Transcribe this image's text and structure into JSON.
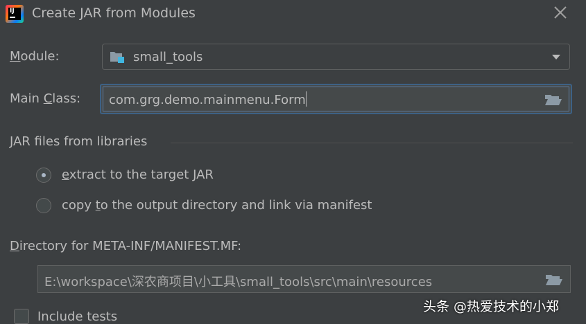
{
  "window": {
    "title": "Create JAR from Modules",
    "app_icon_label": "IJ"
  },
  "module": {
    "label_prefix": "",
    "label_underlined": "M",
    "label_rest": "odule:",
    "value": "small_tools"
  },
  "main_class": {
    "label_prefix": "Main ",
    "label_underlined": "C",
    "label_rest": "lass:",
    "value": "com.grg.demo.mainmenu.Form"
  },
  "jar_libraries": {
    "section_title": "JAR files from libraries",
    "options": [
      {
        "prefix": "",
        "underlined": "e",
        "rest": "xtract to the target JAR",
        "selected": true
      },
      {
        "prefix": "copy ",
        "underlined": "t",
        "rest": "o the output directory and link via manifest",
        "selected": false
      }
    ]
  },
  "manifest_dir": {
    "label_prefix": "",
    "label_underlined": "D",
    "label_rest": "irectory for META-INF/MANIFEST.MF:",
    "value": "E:\\workspace\\深农商项目\\小工具\\small_tools\\src\\main\\resources"
  },
  "include_tests": {
    "label": "Include tests",
    "checked": false
  },
  "watermark": "头条 @热爱技术的小郑",
  "colors": {
    "background": "#3c3f41",
    "text": "#bbbbbb",
    "focus_border": "#3d6185",
    "field_bg": "#45494a",
    "folder_icon": "#8c9aa5",
    "module_badge": "#40b6e0"
  }
}
